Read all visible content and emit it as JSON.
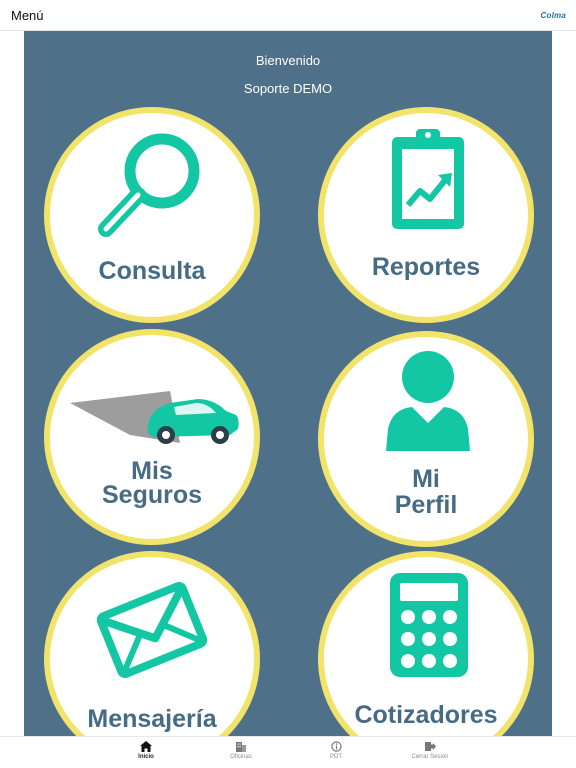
{
  "header": {
    "menu_label": "Menú",
    "brand": "Colma",
    "brand_color": "#1d6fa5"
  },
  "welcome": {
    "greeting": "Bienvenido",
    "user": "Soporte DEMO"
  },
  "colors": {
    "panel_bg": "#4e7089",
    "circle_border": "#f2e46b",
    "icon_teal": "#13c6a4",
    "label_blue": "#456b85"
  },
  "tiles": [
    {
      "label": "Consulta",
      "icon": "magnifier-icon"
    },
    {
      "label": "Reportes",
      "icon": "clipboard-chart-icon"
    },
    {
      "label_line1": "Mis",
      "label_line2": "Seguros",
      "icon": "car-icon"
    },
    {
      "label_line1": "Mi",
      "label_line2": "Perfil",
      "icon": "person-icon"
    },
    {
      "label": "Mensajería",
      "icon": "envelope-icon"
    },
    {
      "label": "Cotizadores",
      "icon": "calculator-icon"
    }
  ],
  "tabbar": {
    "items": [
      {
        "label": "Inicio",
        "icon": "home-icon",
        "active": true
      },
      {
        "label": "Oficinas",
        "icon": "building-icon"
      },
      {
        "label": "PDT",
        "icon": "info-icon"
      },
      {
        "label": "Cerrar Sesión",
        "icon": "logout-icon"
      }
    ]
  }
}
